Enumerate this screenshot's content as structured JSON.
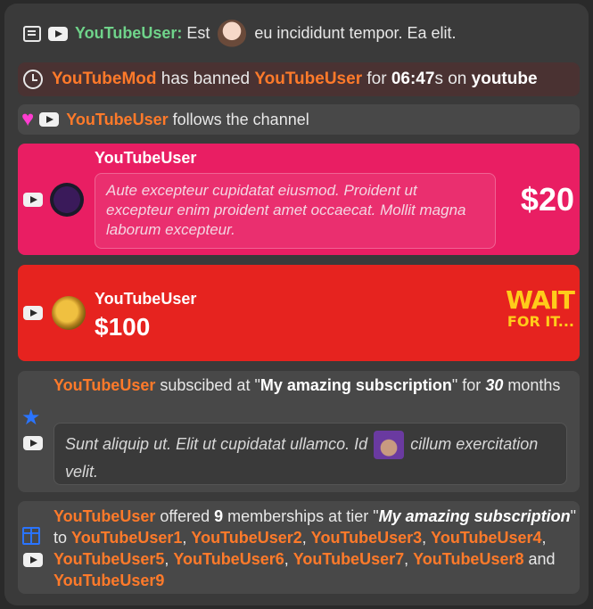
{
  "chat": {
    "user": "YouTubeUser:",
    "before": "Est",
    "after": "eu incididunt tempor. Ea elit."
  },
  "ban": {
    "mod": "YouTubeMod",
    "action": "has banned",
    "target": "YouTubeUser",
    "for": "for",
    "duration": "06:47",
    "unit": "s on",
    "platform": "youtube"
  },
  "follow": {
    "user": "YouTubeUser",
    "text": "follows the channel"
  },
  "superchat1": {
    "user": "YouTubeUser",
    "message": "Aute excepteur cupidatat eiusmod. Proident ut excepteur enim proident amet occaecat. Mollit magna laborum excepteur.",
    "amount": "$20",
    "color": "#e91e63"
  },
  "superchat2": {
    "user": "YouTubeUser",
    "amount": "$100",
    "sticker_line1": "WAIT",
    "sticker_line2": "FOR IT...",
    "color": "#e6231f"
  },
  "subscription": {
    "user": "YouTubeUser",
    "text1": "subscibed at \"",
    "tier": "My amazing subscription",
    "text2": "\" for",
    "months_count": "30",
    "months_label": "months",
    "message_before": "Sunt aliquip ut. Elit ut cupidatat ullamco. Id",
    "message_after": "cillum exercitation velit."
  },
  "gift": {
    "user": "YouTubeUser",
    "text1": "offered",
    "count": "9",
    "text2": "memberships at tier \"",
    "tier": "My amazing subscription",
    "text3": "\" to",
    "recipients": [
      "YouTubeUser1",
      "YouTubeUser2",
      "YouTubeUser3",
      "YouTubeUser4",
      "YouTubeUser5",
      "YouTubeUser6",
      "YouTubeUser7",
      "YouTubeUser8",
      "YouTubeUser9"
    ],
    "and": "and"
  },
  "colors": {
    "username": "#ff7a2a",
    "chat_username": "#6fd38a",
    "heart": "#ff3cd0",
    "star": "#2a74ff"
  }
}
